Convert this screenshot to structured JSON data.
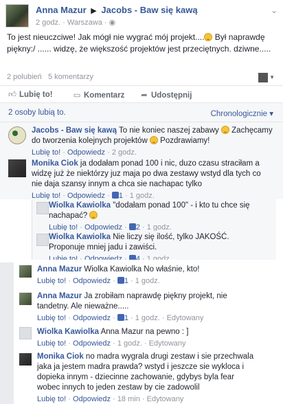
{
  "post": {
    "author": "Anna Mazur",
    "arrow": "▶",
    "target": "Jacobs - Baw się kawą",
    "time": "2 godz.",
    "location": "Warszawa",
    "body": "To jest nieuczciwe! Jak mógł nie wygrać mój projekt.... Był naprawdę piękny:/ ...... widzę, że większość projektów jest przeciętnych. dziwne.....",
    "body_part1": "To jest nieuczciwe! Jak mógł nie wygrać mój projekt....",
    "body_part2": " Był naprawdę piękny:/ ...... widzę, że większość projektów jest przeciętnych. dziwne.....",
    "likes_count": "2 polubień",
    "comments_count": "5 komentarzy"
  },
  "actions": {
    "like": "Lubię to!",
    "comment": "Komentarz",
    "share": "Udostępnij"
  },
  "likers": {
    "text": "2 osoby lubią to.",
    "sort": "Chronologicznie ▾"
  },
  "comments": [
    {
      "author": "Jacobs - Baw się kawą",
      "text_a": " To nie koniec naszej zabawy ",
      "text_b": " Zachęcamy do tworzenia kolejnych projektów ",
      "text_c": " Pozdrawiamy!",
      "like": "Lubię to!",
      "reply": "Odpowiedz",
      "time": "2 godz."
    },
    {
      "author": "Monika Ciok",
      "text": " ja dodałam ponad 100 i nic, duzo czasu straciłam a widzę już że niektórzy juz maja po dwa zestawy wstyd dla tych co nie daja szansy innym a chca sie nachapac tylko",
      "like": "Lubię to!",
      "reply": "Odpowiedz",
      "likes": "1",
      "time": "1 godz."
    },
    {
      "author": "Wiolka Kawiolka",
      "text": " \"dodałam ponad 100\" - i kto tu chce się nachapać? ",
      "like": "Lubię to!",
      "reply": "Odpowiedz",
      "likes": "2",
      "time": "1 godz."
    },
    {
      "author": "Wiolka Kawiolka",
      "text": " Nie liczy się ilość, tylko JAKOŚĆ. Proponuje mniej jadu i zawiści.",
      "like": "Lubię to!",
      "reply": "Odpowiedz",
      "likes": "4",
      "time": "1 godz."
    },
    {
      "author": "Anna Mazur",
      "text": " Wiolka Kawiolka No właśnie, kto!",
      "like": "Lubię to!",
      "reply": "Odpowiedz",
      "likes": "1",
      "time": "1 godz."
    },
    {
      "author": "Anna Mazur",
      "text": " Ja zrobiłam naprawdę piękny projekt, nie tandetny. Ale nieważne.....",
      "like": "Lubię to!",
      "reply": "Odpowiedz",
      "likes": "1",
      "time": "1 godz.",
      "edited": "Edytowany"
    },
    {
      "author": "Wiolka Kawiolka",
      "text": " Anna Mazur na pewno : ]",
      "like": "Lubię to!",
      "reply": "Odpowiedz",
      "time": "1 godz.",
      "edited": "Edytowany"
    },
    {
      "author": "Monika Ciok",
      "text": " no madra wygrala drugi zestaw i sie przechwala jaka ja jestem madra prawda? wstyd i jeszcze sie wykloca i dopieka innym - dziecinne zachowanie, gdybys byla fear wobec innych to jeden zestaw by cie zadowolil",
      "like": "Lubię to!",
      "reply": "Odpowiedz",
      "time": "18 min",
      "edited": "Edytowany"
    }
  ],
  "sep": " · "
}
